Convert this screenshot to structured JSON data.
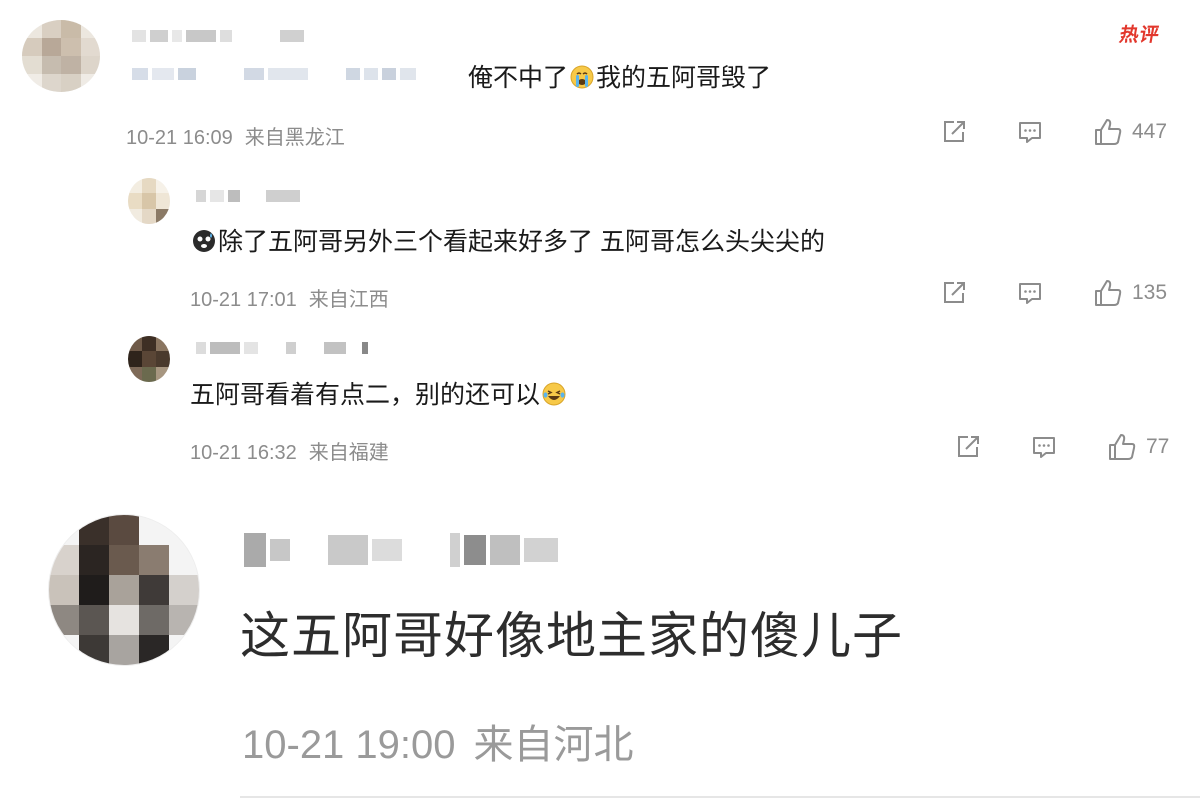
{
  "badge": "热评",
  "comments": [
    {
      "text_before_emoji": "俺不中了",
      "emoji": "crying-face",
      "text_after_emoji": "我的五阿哥毁了",
      "date": "10-21 16:09",
      "location": "来自黑龙江",
      "likes": "447"
    },
    {
      "emoji": "cold-sweat-face",
      "text": "除了五阿哥另外三个看起来好多了 五阿哥怎么头尖尖的",
      "date": "10-21 17:01",
      "location": "来自江西",
      "likes": "135"
    },
    {
      "text": "五阿哥看着有点二，别的还可以",
      "emoji": "laughing-face",
      "date": "10-21 16:32",
      "location": "来自福建",
      "likes": "77"
    }
  ],
  "featured": {
    "text": "这五阿哥好像地主家的傻儿子",
    "date": "10-21 19:00",
    "location": "来自河北"
  },
  "icons": {
    "share": "share-icon",
    "comment": "comment-icon",
    "like": "like-icon"
  },
  "colors": {
    "badge": "#e2372c",
    "meta": "#8c8c8c"
  }
}
